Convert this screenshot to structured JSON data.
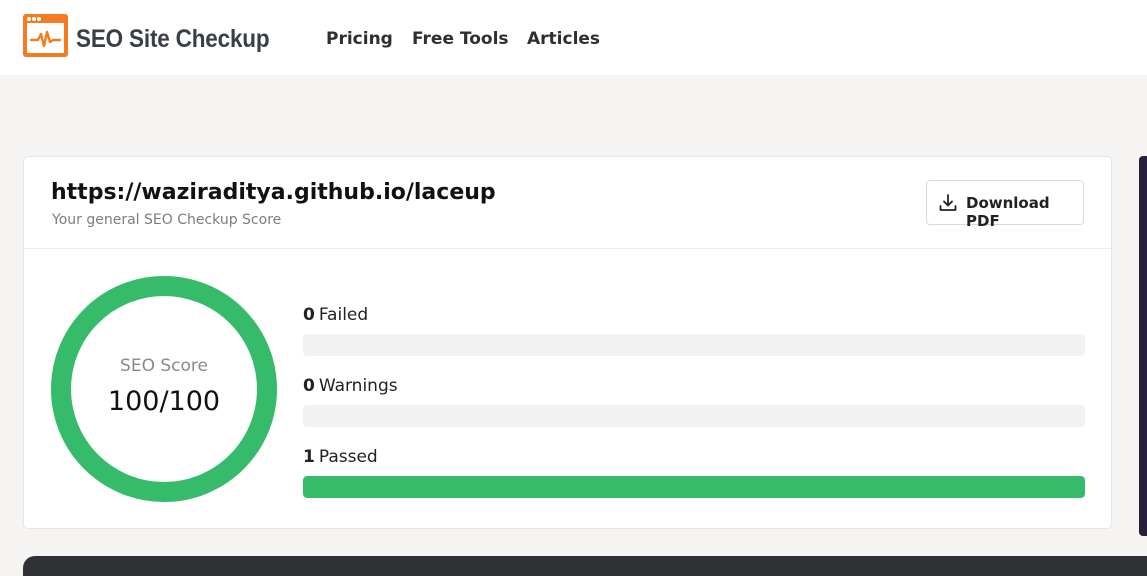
{
  "header": {
    "brand": "SEO Site Checkup",
    "logo_icon": "pulse-window-icon",
    "nav": [
      {
        "label": "Pricing"
      },
      {
        "label": "Free Tools"
      },
      {
        "label": "Articles"
      }
    ]
  },
  "report": {
    "url": "https://waziraditya.github.io/laceup",
    "subtitle": "Your general SEO Checkup Score",
    "download_label": "Download PDF",
    "download_icon": "download-icon",
    "score_label": "SEO Score",
    "score_text": "100/100",
    "score_value": 100,
    "score_max": 100,
    "stats": [
      {
        "count": "0",
        "label": "Failed",
        "fraction": 0,
        "color": "#e74c3c"
      },
      {
        "count": "0",
        "label": "Warnings",
        "fraction": 0,
        "color": "#f5a623"
      },
      {
        "count": "1",
        "label": "Passed",
        "fraction": 1,
        "color": "#35bb6a"
      }
    ]
  },
  "colors": {
    "brand": "#f47b20",
    "score_ring": "#35bb6a",
    "track": "#f2f2f2"
  }
}
